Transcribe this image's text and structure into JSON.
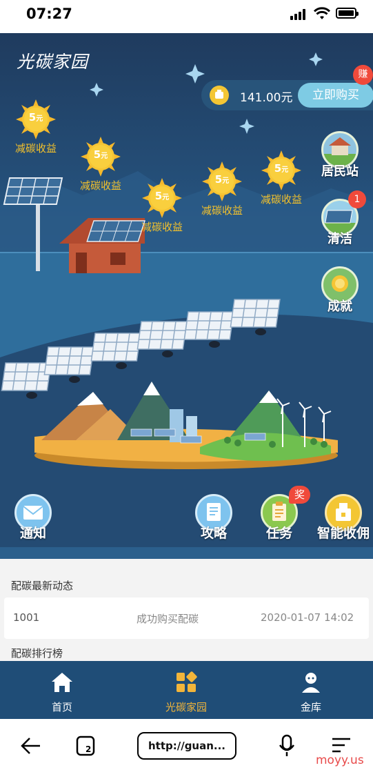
{
  "status": {
    "time": "07:27"
  },
  "app": {
    "logo": "光碳家园"
  },
  "suns": [
    {
      "value": "5",
      "unit": "元",
      "label": "减碳收益"
    },
    {
      "value": "5",
      "unit": "元",
      "label": "减碳收益"
    },
    {
      "value": "5",
      "unit": "元",
      "label": "减碳收益"
    },
    {
      "value": "5",
      "unit": "元",
      "label": "减碳收益"
    },
    {
      "value": "5",
      "unit": "元",
      "label": "减碳收益"
    }
  ],
  "buy": {
    "amount": "141.00元",
    "button": "立即购买",
    "badge": "赚"
  },
  "side": {
    "resident": "居民站",
    "clean": "清洁",
    "clean_badge": "1",
    "achievement": "成就"
  },
  "actions": {
    "notice": "通知",
    "guide": "攻略",
    "task": "任务",
    "task_badge": "奖",
    "smart": "智能收佣"
  },
  "news": {
    "title": "配碳最新动态",
    "row": {
      "id": "1001",
      "event": "成功购买配碳",
      "time": "2020-01-07 14:02"
    },
    "ranking_title": "配碳排行榜"
  },
  "tabs": [
    {
      "label": "首页"
    },
    {
      "label": "光碳家园"
    },
    {
      "label": "金库"
    }
  ],
  "browser": {
    "url": "http://guan..."
  },
  "watermark": "moyy.us",
  "colors": {
    "accent": "#f2b53a",
    "sun": "#f5c22b",
    "badge": "#f04a3b",
    "tabbar": "#1f4d77"
  }
}
